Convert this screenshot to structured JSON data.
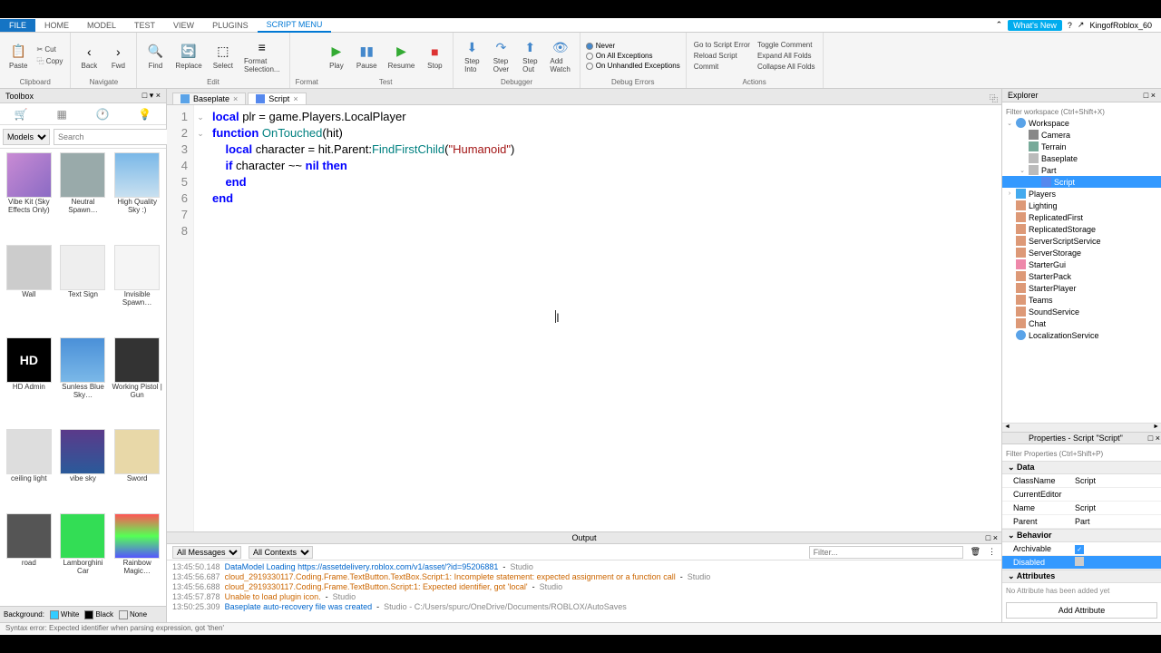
{
  "menubar": {
    "file": "FILE",
    "items": [
      "HOME",
      "MODEL",
      "TEST",
      "VIEW",
      "PLUGINS",
      "SCRIPT MENU"
    ],
    "active": 5,
    "whatsnew": "What's New",
    "user": "KingofRoblox_60"
  },
  "ribbon": {
    "clipboard": {
      "paste": "Paste",
      "cut": "Cut",
      "copy": "Copy",
      "label": "Clipboard"
    },
    "navigate": {
      "back": "Back",
      "fwd": "Fwd",
      "label": "Navigate"
    },
    "edit": {
      "find": "Find",
      "replace": "Replace",
      "select": "Select",
      "format_sel": "Format\nSelection...",
      "format_label": "Format",
      "label": "Edit"
    },
    "test": {
      "play": "Play",
      "pause": "Pause",
      "resume": "Resume",
      "stop": "Stop",
      "label": "Test"
    },
    "debugger": {
      "step_into": "Step\nInto",
      "step_over": "Step\nOver",
      "step_out": "Step\nOut",
      "add_watch": "Add\nWatch",
      "label": "Debugger"
    },
    "debug_errors": {
      "never": "Never",
      "all_exc": "On All Exceptions",
      "unhandled": "On Unhandled Exceptions",
      "label": "Debug Errors"
    },
    "actions": {
      "goto_err": "Go to Script Error",
      "reload": "Reload Script",
      "commit": "Commit",
      "toggle": "Toggle Comment",
      "expand": "Expand All Folds",
      "collapse": "Collapse All Folds",
      "label": "Actions"
    }
  },
  "toolbox": {
    "title": "Toolbox",
    "category": "Models",
    "search_ph": "Search",
    "items": [
      {
        "label": "Vibe Kit (Sky Effects Only)",
        "bg": "linear-gradient(135deg,#c98bd4,#8b6bc4)"
      },
      {
        "label": "Neutral Spawn…",
        "bg": "#9aa"
      },
      {
        "label": "High Quality Sky :)",
        "bg": "linear-gradient(#7ab8e8,#c8e0f0)"
      },
      {
        "label": "Wall",
        "bg": "#ccc"
      },
      {
        "label": "Text Sign",
        "bg": "#eee"
      },
      {
        "label": "Invisible Spawn…",
        "bg": "#f5f5f5"
      },
      {
        "label": "HD Admin",
        "bg": "#000",
        "text": "HD",
        "tc": "#fff"
      },
      {
        "label": "Sunless Blue Sky…",
        "bg": "linear-gradient(#4a90d8,#7ab8e8)"
      },
      {
        "label": "Working Pistol | Gun",
        "bg": "#333"
      },
      {
        "label": "ceiling light",
        "bg": "#ddd"
      },
      {
        "label": "vibe sky",
        "bg": "linear-gradient(#5b3a8a,#2a5a9a)"
      },
      {
        "label": "Sword",
        "bg": "#e8d8a8"
      },
      {
        "label": "road",
        "bg": "#555"
      },
      {
        "label": "Lamborghini Car",
        "bg": "#3d5"
      },
      {
        "label": "Rainbow Magic…",
        "bg": "linear-gradient(#f55,#5f5,#55f)"
      }
    ],
    "bg_label": "Background:",
    "bg_opts": [
      "White",
      "Black",
      "None"
    ]
  },
  "tabs": [
    {
      "label": "Baseplate",
      "color": "#5aa3e8"
    },
    {
      "label": "Script",
      "color": "#58e"
    }
  ],
  "active_tab": 1,
  "code": {
    "lines": [
      [
        {
          "t": "local ",
          "c": "kw"
        },
        {
          "t": "plr = game.Players.LocalPlayer"
        }
      ],
      [],
      [
        {
          "t": "function ",
          "c": "kw"
        },
        {
          "t": "OnTouched",
          "c": "fn"
        },
        {
          "t": "(hit)"
        }
      ],
      [
        {
          "t": "    "
        },
        {
          "t": "local ",
          "c": "kw"
        },
        {
          "t": "character = hit.Parent:"
        },
        {
          "t": "FindFirstChild",
          "c": "fn"
        },
        {
          "t": "("
        },
        {
          "t": "\"Humanoid\"",
          "c": "str"
        },
        {
          "t": ")"
        }
      ],
      [
        {
          "t": "    "
        },
        {
          "t": "if ",
          "c": "kw"
        },
        {
          "t": "character ~~ "
        },
        {
          "t": "nil",
          "c": "nil"
        },
        {
          "t": " then",
          "c": "kw"
        }
      ],
      [],
      [
        {
          "t": "    "
        },
        {
          "t": "end",
          "c": "kw"
        }
      ],
      [
        {
          "t": "end",
          "c": "kw"
        }
      ]
    ],
    "folds": {
      "3": "⌄",
      "5": "⌄"
    }
  },
  "output": {
    "title": "Output",
    "filter_all": "All Messages",
    "filter_ctx": "All Contexts",
    "filter_ph": "Filter...",
    "lines": [
      {
        "ts": "13:45:50.148",
        "msg": "DataModel Loading https://assetdelivery.roblox.com/v1/asset/?id=95206881",
        "src": "Studio",
        "c": "msg"
      },
      {
        "ts": "13:45:56.687",
        "msg": "cloud_2919330117.Coding.Frame.TextButton.TextBox.Script:1: Incomplete statement: expected assignment or a function call",
        "src": "Studio",
        "c": "msg warn"
      },
      {
        "ts": "13:45:56.688",
        "msg": "cloud_2919330117.Coding.Frame.TextButton.Script:1: Expected identifier, got 'local'",
        "src": "Studio",
        "c": "msg warn"
      },
      {
        "ts": "13:45:57.878",
        "msg": "Unable to load plugin icon.",
        "src": "Studio",
        "c": "msg warn"
      },
      {
        "ts": "13:50:25.309",
        "msg": "Baseplate auto-recovery file was created",
        "src": "Studio - C:/Users/spurc/OneDrive/Documents/ROBLOX/AutoSaves",
        "c": "msg"
      }
    ]
  },
  "explorer": {
    "title": "Explorer",
    "filter_ph": "Filter workspace (Ctrl+Shift+X)",
    "tree": [
      {
        "ind": 0,
        "arrow": "⌄",
        "icon": "icon-ws",
        "label": "Workspace"
      },
      {
        "ind": 1,
        "arrow": "",
        "icon": "icon-cam",
        "label": "Camera"
      },
      {
        "ind": 1,
        "arrow": "",
        "icon": "icon-terr",
        "label": "Terrain"
      },
      {
        "ind": 1,
        "arrow": "",
        "icon": "icon-part",
        "label": "Baseplate"
      },
      {
        "ind": 1,
        "arrow": "⌄",
        "icon": "icon-part",
        "label": "Part"
      },
      {
        "ind": 2,
        "arrow": "",
        "icon": "icon-script",
        "label": "Script",
        "sel": true
      },
      {
        "ind": 0,
        "arrow": "›",
        "icon": "icon-players",
        "label": "Players"
      },
      {
        "ind": 0,
        "arrow": "",
        "icon": "icon-svc",
        "label": "Lighting"
      },
      {
        "ind": 0,
        "arrow": "",
        "icon": "icon-svc",
        "label": "ReplicatedFirst"
      },
      {
        "ind": 0,
        "arrow": "",
        "icon": "icon-svc",
        "label": "ReplicatedStorage"
      },
      {
        "ind": 0,
        "arrow": "",
        "icon": "icon-svc",
        "label": "ServerScriptService"
      },
      {
        "ind": 0,
        "arrow": "",
        "icon": "icon-svc",
        "label": "ServerStorage"
      },
      {
        "ind": 0,
        "arrow": "",
        "icon": "icon-gui",
        "label": "StarterGui"
      },
      {
        "ind": 0,
        "arrow": "",
        "icon": "icon-svc",
        "label": "StarterPack"
      },
      {
        "ind": 0,
        "arrow": "",
        "icon": "icon-svc",
        "label": "StarterPlayer"
      },
      {
        "ind": 0,
        "arrow": "",
        "icon": "icon-svc",
        "label": "Teams"
      },
      {
        "ind": 0,
        "arrow": "",
        "icon": "icon-svc",
        "label": "SoundService"
      },
      {
        "ind": 0,
        "arrow": "",
        "icon": "icon-svc",
        "label": "Chat"
      },
      {
        "ind": 0,
        "arrow": "",
        "icon": "icon-ws",
        "label": "LocalizationService"
      }
    ]
  },
  "properties": {
    "title": "Properties - Script \"Script\"",
    "filter_ph": "Filter Properties (Ctrl+Shift+P)",
    "groups": [
      {
        "name": "Data",
        "rows": [
          {
            "k": "ClassName",
            "v": "Script"
          },
          {
            "k": "CurrentEditor",
            "v": ""
          },
          {
            "k": "Name",
            "v": "Script"
          },
          {
            "k": "Parent",
            "v": "Part"
          }
        ]
      },
      {
        "name": "Behavior",
        "rows": [
          {
            "k": "Archivable",
            "v": "check"
          },
          {
            "k": "Disabled",
            "v": "uncheck",
            "sel": true
          }
        ]
      },
      {
        "name": "Attributes",
        "rows": []
      }
    ],
    "no_attr": "No Attribute has been added yet",
    "add_attr": "Add Attribute"
  },
  "statusbar": "Syntax error: Expected identifier when parsing expression, got 'then'"
}
